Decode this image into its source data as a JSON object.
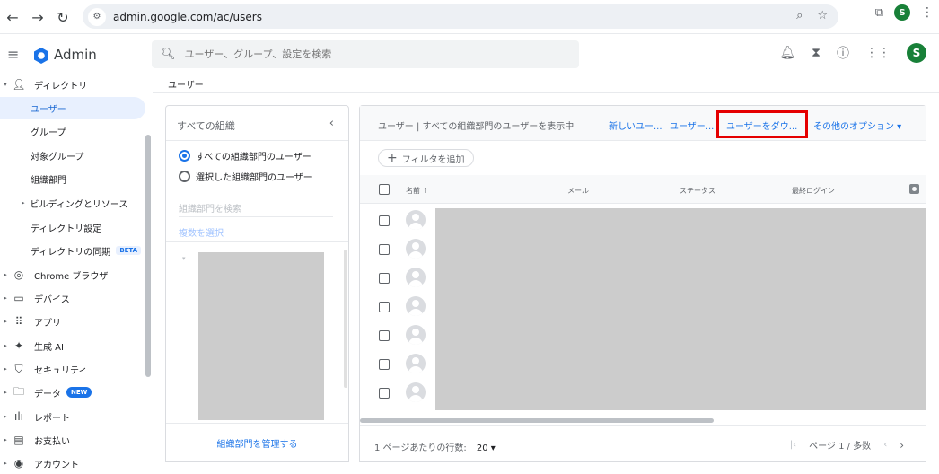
{
  "browser": {
    "url": "admin.google.com/ac/users",
    "profile_initial": "S"
  },
  "header": {
    "app_name": "Admin",
    "search_placeholder": "ユーザー、グループ、設定を検索",
    "avatar_initial": "S"
  },
  "sidebar": {
    "directory": "ディレクトリ",
    "users": "ユーザー",
    "groups": "グループ",
    "target_groups": "対象グループ",
    "org_units": "組織部門",
    "buildings": "ビルディングとリソース",
    "directory_settings": "ディレクトリ設定",
    "directory_sync": "ディレクトリの同期",
    "beta": "BETA",
    "chrome": "Chrome ブラウザ",
    "devices": "デバイス",
    "apps": "アプリ",
    "gen_ai": "生成 AI",
    "security": "セキュリティ",
    "data": "データ",
    "new_badge": "NEW",
    "reports": "レポート",
    "billing": "お支払い",
    "account": "アカウント"
  },
  "breadcrumb": "ユーザー",
  "org_panel": {
    "title": "すべての組織",
    "radio_all": "すべての組織部門のユーザー",
    "radio_selected": "選択した組織部門のユーザー",
    "search_placeholder": "組織部門を検索",
    "multi_select": "複数を選択",
    "manage_link": "組織部門を管理する"
  },
  "users_panel": {
    "status": "ユーザー | すべての組織部門のユーザーを表示中",
    "new_user": "新しいユー...",
    "user_action": "ユーザー...",
    "download_users": "ユーザーをダウ...",
    "more_options": "その他のオプション ▾",
    "add_filter": "フィルタを追加",
    "columns": {
      "name": "名前 ↑",
      "email": "メール",
      "status": "ステータス",
      "last_login": "最終ログイン"
    },
    "rows_per_page_label": "1 ページあたりの行数:",
    "rows_per_page_value": "20 ▾",
    "page_indicator": "ページ 1 / 多数"
  }
}
